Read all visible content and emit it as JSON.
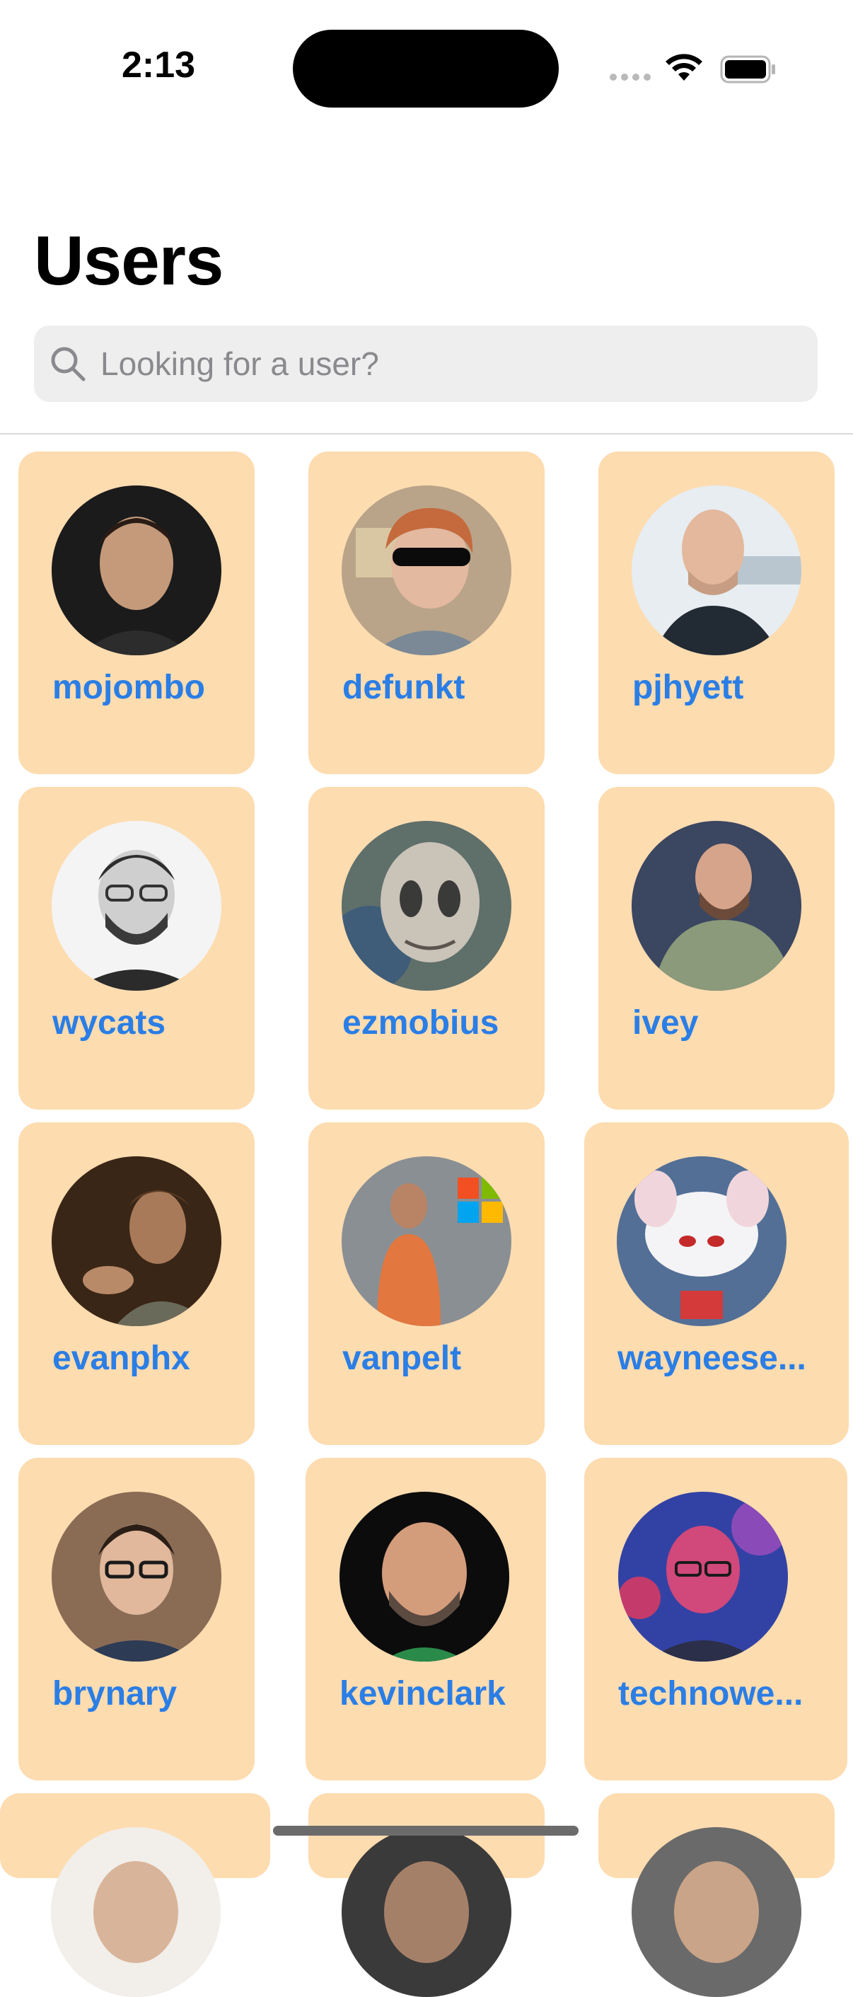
{
  "status_bar": {
    "time": "2:13"
  },
  "page": {
    "title": "Users"
  },
  "search": {
    "placeholder": "Looking for a user?",
    "value": ""
  },
  "users": [
    {
      "login": "mojombo",
      "avatar_colors": [
        "#1b1b1b",
        "#c49a7b"
      ]
    },
    {
      "login": "defunkt",
      "avatar_colors": [
        "#b9a489",
        "#c46a3d"
      ]
    },
    {
      "login": "pjhyett",
      "avatar_colors": [
        "#e7edf1",
        "#222a33"
      ]
    },
    {
      "login": "wycats",
      "avatar_colors": [
        "#f4f4f4",
        "#3a3a3a"
      ]
    },
    {
      "login": "ezmobius",
      "avatar_colors": [
        "#5f6f6a",
        "#c9c3b8"
      ]
    },
    {
      "login": "ivey",
      "avatar_colors": [
        "#3b4660",
        "#8a9a7a"
      ]
    },
    {
      "login": "evanphx",
      "avatar_colors": [
        "#3a2616",
        "#a87a5a"
      ]
    },
    {
      "login": "vanpelt",
      "avatar_colors": [
        "#8a8f93",
        "#e2773f"
      ]
    },
    {
      "login": "wayneese...",
      "avatar_colors": [
        "#536f96",
        "#f4f4f6"
      ]
    },
    {
      "login": "brynary",
      "avatar_colors": [
        "#8a6c55",
        "#2d3b55"
      ]
    },
    {
      "login": "kevinclark",
      "avatar_colors": [
        "#0c0c0c",
        "#d39c7b"
      ]
    },
    {
      "login": "technowe...",
      "avatar_colors": [
        "#3242a4",
        "#d1487a"
      ]
    }
  ],
  "colors": {
    "card_background": "#fddcb0",
    "username_text": "#2a7ee6",
    "search_background": "#eeeeee",
    "placeholder_text": "#8a8a8e"
  }
}
